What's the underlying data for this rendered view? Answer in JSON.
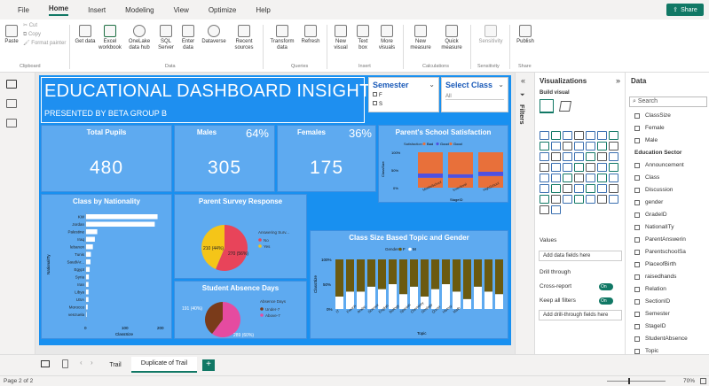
{
  "menu": {
    "file": "File",
    "home": "Home",
    "insert": "Insert",
    "modeling": "Modeling",
    "view": "View",
    "optimize": "Optimize",
    "help": "Help",
    "share": "Share"
  },
  "ribbon": {
    "paste": "Paste",
    "cut": "Cut",
    "copy": "Copy",
    "format_painter": "Format painter",
    "get_data": "Get data",
    "excel": "Excel workbook",
    "onelake": "OneLake data hub",
    "sql": "SQL Server",
    "enter_data": "Enter data",
    "dataverse": "Dataverse",
    "recent": "Recent sources",
    "transform": "Transform data",
    "refresh": "Refresh",
    "new_visual": "New visual",
    "text_box": "Text box",
    "more_visuals": "More visuals",
    "new_measure": "New measure",
    "quick_measure": "Quick measure",
    "sensitivity": "Sensitivity",
    "publish": "Publish",
    "g_clipboard": "Clipboard",
    "g_data": "Data",
    "g_queries": "Queries",
    "g_insert": "Insert",
    "g_calculations": "Calculations",
    "g_sensitivity": "Sensitivity",
    "g_share": "Share"
  },
  "dashboard": {
    "title": "EDUCATIONAL DASHBOARD INSIGHT",
    "subtitle": "PRESENTED BY BETA GROUP B",
    "semester_slicer": {
      "title": "Semester",
      "options": [
        "F",
        "S"
      ]
    },
    "class_slicer": {
      "title": "Select Class",
      "value": "All"
    },
    "kpis": [
      {
        "title": "Total Pupils",
        "value": "480",
        "pct": ""
      },
      {
        "title": "Males",
        "value": "305",
        "pct": "64%"
      },
      {
        "title": "Females",
        "value": "175",
        "pct": "36%"
      }
    ],
    "nationality": {
      "title": "Class by Nationality",
      "ylabel": "NationalITy",
      "xlabel": "ClassSize",
      "ticks": [
        "0",
        "100",
        "200"
      ]
    },
    "survey": {
      "title": "Parent Survey Response",
      "legend_title": "Answering Surv...",
      "legend_items": [
        "No",
        "Yes"
      ],
      "label_a": "210 (44%)",
      "label_b": "270 (56%)"
    },
    "absence": {
      "title": "Student Absence Days",
      "legend_title": "Absence Days",
      "legend_items": [
        "Under-7",
        "Above-7"
      ],
      "label_a": "191 (40%)",
      "label_b": "289 (60%)"
    },
    "satisfaction": {
      "title": "Parent's School Satisfaction",
      "legend_title": "Satisfaction",
      "legend_items": [
        "Bad",
        "Good",
        "Good"
      ],
      "ylabel": "ClassSize",
      "xlabel": "StageID",
      "yticks": [
        "100%",
        "50%",
        "0%"
      ],
      "categories": [
        "MiddleSchool",
        "lowerlevel",
        "HighSchool"
      ]
    },
    "topic": {
      "title": "Class Size Based Topic and Gender",
      "legend_title": "Gender",
      "legend_items": [
        "F",
        "M"
      ],
      "ylabel": "ClassSize",
      "xlabel": "Topic",
      "yticks": [
        "100%",
        "50%",
        "0%"
      ],
      "categories": [
        "IT",
        "French",
        "Arabic",
        "Science",
        "English",
        "Biology",
        "Spanish",
        "Chemistry",
        "Geology",
        "Quran",
        "History",
        "Math"
      ]
    }
  },
  "chart_data": [
    {
      "type": "bar",
      "title": "Class by Nationality",
      "categories": [
        "KW",
        "Jordan",
        "Palestine",
        "Iraq",
        "lebanon",
        "Tunis",
        "SaudiAr...",
        "Egypt",
        "Syria",
        "Iran",
        "Libya",
        "USA",
        "Morocco",
        "venzuela"
      ],
      "values": [
        179,
        172,
        28,
        22,
        17,
        12,
        11,
        9,
        7,
        6,
        6,
        6,
        4,
        1
      ],
      "xlabel": "ClassSize",
      "ylabel": "NationalITy",
      "xlim": [
        0,
        200
      ]
    },
    {
      "type": "pie",
      "title": "Parent Survey Response",
      "categories": [
        "No",
        "Yes"
      ],
      "values": [
        210,
        270
      ]
    },
    {
      "type": "pie",
      "title": "Student Absence Days",
      "categories": [
        "Above-7",
        "Under-7"
      ],
      "values": [
        191,
        289
      ]
    },
    {
      "type": "bar",
      "title": "Parent's School Satisfaction",
      "categories": [
        "MiddleSchool",
        "lowerlevel",
        "HighSchool"
      ],
      "series": [
        {
          "name": "Bad",
          "values": [
            0.6,
            0.62,
            0.55
          ]
        },
        {
          "name": "Good",
          "values": [
            0.12,
            0.1,
            0.12
          ]
        },
        {
          "name": "Good",
          "values": [
            0.28,
            0.28,
            0.33
          ]
        }
      ],
      "ylim": [
        0,
        1
      ]
    },
    {
      "type": "bar",
      "title": "Class Size Based Topic and Gender",
      "categories": [
        "IT",
        "French",
        "Arabic",
        "Science",
        "English",
        "Biology",
        "Spanish",
        "Chemistry",
        "Geology",
        "Quran",
        "History",
        "Math",
        "Music",
        "Art",
        "Sports",
        "Others"
      ],
      "series": [
        {
          "name": "F",
          "values": [
            0.25,
            0.35,
            0.35,
            0.45,
            0.4,
            0.5,
            0.3,
            0.45,
            0.25,
            0.4,
            0.5,
            0.35,
            0.2,
            0.45,
            0.35,
            0.3
          ]
        },
        {
          "name": "M",
          "values": [
            0.75,
            0.65,
            0.65,
            0.55,
            0.6,
            0.5,
            0.7,
            0.55,
            0.75,
            0.6,
            0.5,
            0.65,
            0.8,
            0.55,
            0.65,
            0.7
          ]
        }
      ],
      "ylim": [
        0,
        1
      ]
    }
  ],
  "pages": {
    "tab1": "Trail",
    "tab2": "Duplicate of Trail",
    "status": "Page 2 of 2",
    "zoom": "70%"
  },
  "viz": {
    "title": "Visualizations",
    "build": "Build visual",
    "values": "Values",
    "values_placeholder": "Add data fields here",
    "drill": "Drill through",
    "cross": "Cross-report",
    "keep": "Keep all filters",
    "on": "On",
    "drill_placeholder": "Add drill-through fields here",
    "filters": "Filters"
  },
  "data": {
    "title": "Data",
    "search_placeholder": "Search",
    "fields": [
      "ClassSize",
      "Female",
      "Male",
      "Education Sector",
      "Announcement",
      "Class",
      "Discussion",
      "gender",
      "GradeID",
      "NationalITy",
      "ParentAnswerin",
      "ParentschoolSa",
      "PlaceofBirth",
      "raisedhands",
      "Relation",
      "SectionID",
      "Semester",
      "StageID",
      "StudentAbsence",
      "Topic",
      "VisITedResourc"
    ]
  },
  "colors": {
    "accent": "#117865",
    "report_bg": "#1890f0",
    "tile": "#5eaaf0",
    "pie_red": "#e8445a",
    "pie_yellow": "#f5c518",
    "pie_pink": "#e54ba0",
    "pie_brown": "#7a3b1a",
    "bar_orange": "#e8703a",
    "bar_blue": "#5050e0",
    "bar_olive": "#6b5a10"
  }
}
